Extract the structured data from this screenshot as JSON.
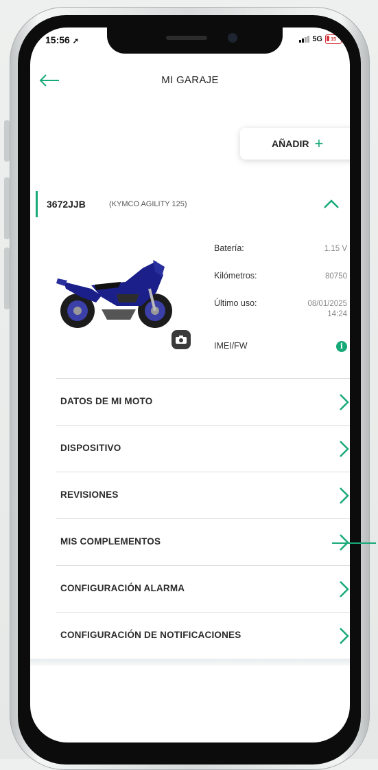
{
  "status": {
    "time": "15:56",
    "network": "5G",
    "battery": "15"
  },
  "header": {
    "title": "MI GARAJE"
  },
  "add_button": {
    "label": "AÑADIR",
    "icon": "plus-icon"
  },
  "vehicle": {
    "plate": "3672JJB",
    "model": "(KYMCO AGILITY 125)",
    "info": [
      {
        "label": "Batería:",
        "value": "1.15 V"
      },
      {
        "label": "Kilómetros:",
        "value": "80750"
      },
      {
        "label": "Último uso:",
        "value": "08/01/2025 14:24"
      },
      {
        "label": "IMEI/FW",
        "value": ""
      }
    ]
  },
  "menu": [
    {
      "label": "DATOS DE MI MOTO"
    },
    {
      "label": "DISPOSITIVO"
    },
    {
      "label": "REVISIONES"
    },
    {
      "label": "MIS COMPLEMENTOS"
    },
    {
      "label": "CONFIGURACIÓN ALARMA"
    },
    {
      "label": "CONFIGURACIÓN DE NOTIFICACIONES"
    }
  ],
  "colors": {
    "accent": "#17a978",
    "text": "#222222",
    "divider": "#dddddd",
    "moto_blue": "#1a1f8a"
  }
}
